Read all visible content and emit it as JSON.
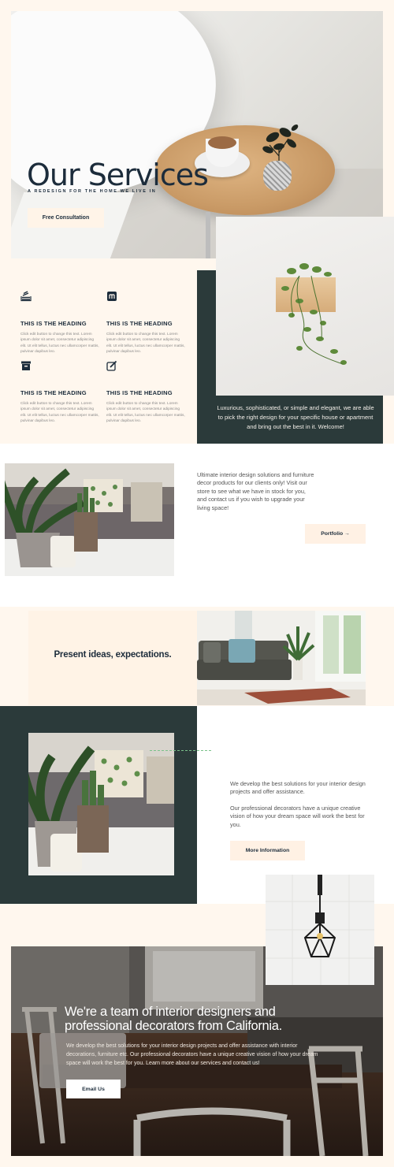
{
  "hero": {
    "title": "Our Services",
    "subtitle": "A REDESIGN FOR THE HOME WE LIVE IN",
    "button_label": "Free Consultation"
  },
  "features": [
    {
      "icon": "stack-icon",
      "heading": "THIS IS THE HEADING",
      "text": "Click edit button to change this text. Lorem ipsum dolor sit amet, consectetur adipiscing elit. Ut elit tellus, luctus nec ullamcorper mattis, pulvinar dapibus leo."
    },
    {
      "icon": "gift-icon",
      "heading": "THIS IS THE HEADING",
      "text": "Click edit button to change this text. Lorem ipsum dolor sit amet, consectetur adipiscing elit. Ut elit tellus, luctus nec ullamcorper mattis, pulvinar dapibus leo."
    },
    {
      "icon": "archive-icon",
      "heading": "THIS IS THE HEADING",
      "text": "Click edit button to change this text. Lorem ipsum dolor sit amet, consectetur adipiscing elit. Ut elit tellus, luctus nec ullamcorper mattis, pulvinar dapibus leo."
    },
    {
      "icon": "edit-icon",
      "heading": "THIS IS THE HEADING",
      "text": "Click edit button to change this text. Lorem ipsum dolor sit amet, consectetur adipiscing elit. Ut elit tellus, luctus nec ullamcorper mattis, pulvinar dapibus leo."
    }
  ],
  "quote": {
    "text": "Luxurious, sophisticated, or simple and elegant, we are able to pick the right design for your specific house or apartment and bring out the best in it. Welcome!"
  },
  "portfolio": {
    "text": "Ultimate interior design solutions and furniture decor products for our clients only! Visit our store to see what we have in stock for you, and contact us if you wish to upgrade your living space!",
    "button_label": "Portfolio →"
  },
  "present": {
    "title": "Present ideas, expectations."
  },
  "develop": {
    "text1": "We develop the best solutions for your interior design projects and offer assistance.",
    "text2": "Our professional decorators have a unique creative vision of how your dream space will work the best for you.",
    "button_label": "More Information"
  },
  "team": {
    "title": "We're a team of interior designers and professional decorators from California.",
    "text": "We develop the best solutions for your interior design projects and offer assistance with interior decorations, furniture etc. Our professional decorators have a unique creative vision of how your dream space will work the best for you. Learn more about our services and contact us!",
    "button_label": "Email Us"
  },
  "colors": {
    "background": "#fff7ee",
    "dark_panel": "#2b3a3a",
    "accent_text": "#1c2c3b",
    "button_bg": "#fff1e4"
  }
}
